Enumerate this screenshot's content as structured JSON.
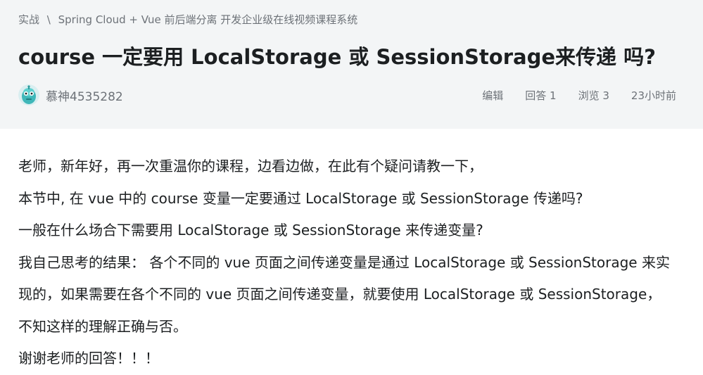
{
  "breadcrumb": {
    "section": "实战",
    "separator": "\\",
    "course": "Spring Cloud + Vue 前后端分离 开发企业级在线视频课程系统"
  },
  "question": {
    "title": "course 一定要用 LocalStorage 或 SessionStorage来传递 吗?"
  },
  "meta": {
    "author": "慕神4535282",
    "edit_label": "编辑",
    "answers": "回答 1",
    "views": "浏览 3",
    "time": "23小时前",
    "avatar_icon": "teal-robot-avatar-icon"
  },
  "content": {
    "lines": [
      "老师，新年好，再一次重温你的课程，边看边做，在此有个疑问请教一下，",
      "本节中, 在 vue 中的 course 变量一定要通过 LocalStorage 或 SessionStorage 传递吗?",
      "一般在什么场合下需要用 LocalStorage 或 SessionStorage 来传递变量?",
      "我自己思考的结果： 各个不同的 vue 页面之间传递变量是通过 LocalStorage 或 SessionStorage 来实现的，如果需要在各个不同的 vue 页面之间传递变量，就要使用 LocalStorage 或 SessionStorage，",
      "不知这样的理解正确与否。",
      "谢谢老师的回答！！！"
    ]
  },
  "colors": {
    "header_bg": "#f3f5f6",
    "text_primary": "#1c1f21",
    "text_secondary": "#6d7278"
  }
}
